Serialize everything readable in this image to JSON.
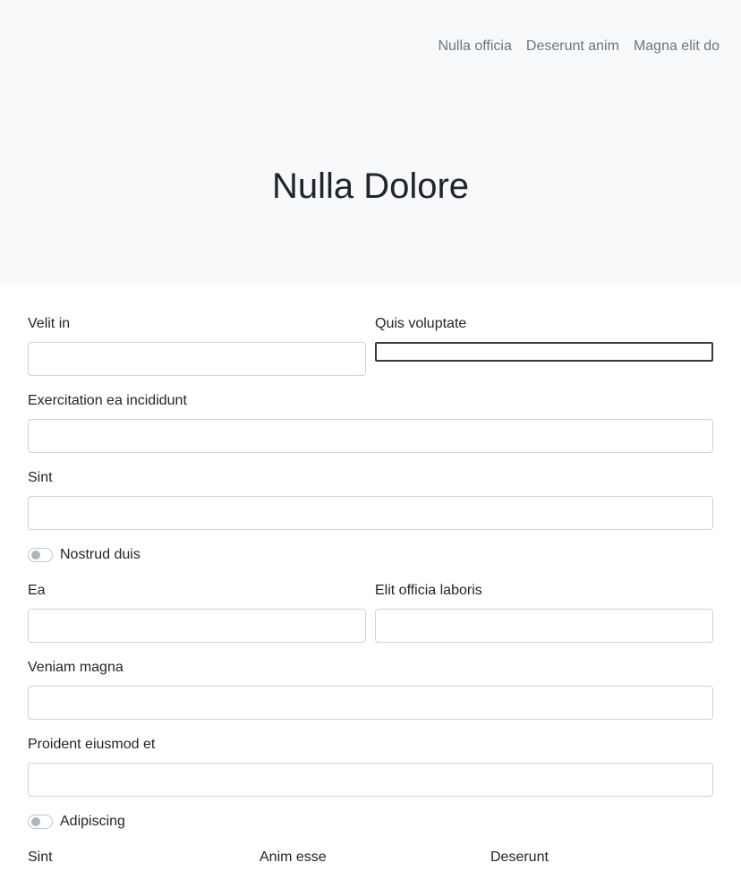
{
  "nav": {
    "items": [
      "Nulla officia",
      "Deserunt anim",
      "Magna elit do"
    ]
  },
  "hero": {
    "title": "Nulla Dolore"
  },
  "form": {
    "velit_in": {
      "label": "Velit in",
      "value": ""
    },
    "quis_voluptate": {
      "label": "Quis voluptate",
      "value": ""
    },
    "exercitation": {
      "label": "Exercitation ea incididunt",
      "value": ""
    },
    "sint": {
      "label": "Sint",
      "value": ""
    },
    "nostrud_toggle": {
      "label": "Nostrud duis",
      "checked": false
    },
    "ea": {
      "label": "Ea",
      "value": ""
    },
    "elit_officia": {
      "label": "Elit officia laboris",
      "value": ""
    },
    "veniam": {
      "label": "Veniam magna",
      "value": ""
    },
    "proident": {
      "label": "Proident eiusmod et",
      "value": ""
    },
    "adipiscing_toggle": {
      "label": "Adipiscing",
      "checked": false
    },
    "row3": {
      "sint_label": "Sint",
      "anim_esse_label": "Anim esse",
      "deserunt_label": "Deserunt"
    }
  },
  "colors": {
    "hero_bg": "#f8f9fa",
    "nav_text": "#6c757d",
    "text": "#212529",
    "border": "#ced4da",
    "focus_border": "#3a3a3a"
  }
}
